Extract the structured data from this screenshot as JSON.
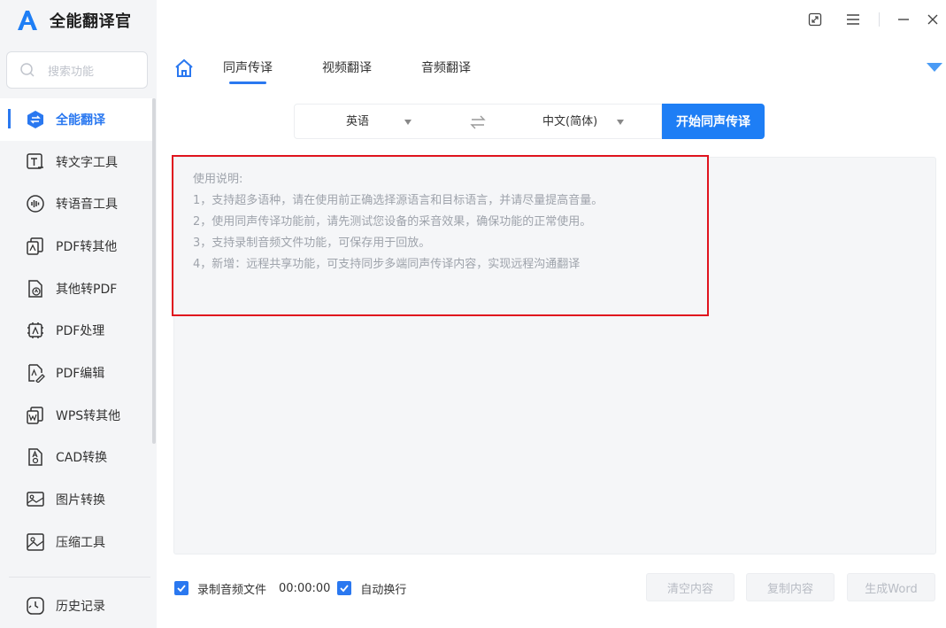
{
  "app": {
    "title": "全能翻译官"
  },
  "search": {
    "placeholder": "搜索功能"
  },
  "sidebar": {
    "items": [
      {
        "label": "全能翻译",
        "icon": "translate-icon",
        "active": true
      },
      {
        "label": "转文字工具",
        "icon": "text-tool-icon"
      },
      {
        "label": "转语音工具",
        "icon": "voice-tool-icon"
      },
      {
        "label": "PDF转其他",
        "icon": "pdf-convert-icon"
      },
      {
        "label": "其他转PDF",
        "icon": "to-pdf-icon"
      },
      {
        "label": "PDF处理",
        "icon": "pdf-process-icon"
      },
      {
        "label": "PDF编辑",
        "icon": "pdf-edit-icon"
      },
      {
        "label": "WPS转其他",
        "icon": "wps-convert-icon"
      },
      {
        "label": "CAD转换",
        "icon": "cad-convert-icon"
      },
      {
        "label": "图片转换",
        "icon": "image-convert-icon"
      },
      {
        "label": "压缩工具",
        "icon": "compress-icon"
      }
    ],
    "history": {
      "label": "历史记录",
      "icon": "history-icon"
    }
  },
  "tabs": [
    {
      "label": "同声传译",
      "active": true
    },
    {
      "label": "视频翻译"
    },
    {
      "label": "音频翻译"
    }
  ],
  "language": {
    "source": "英语",
    "target": "中文(简体)",
    "start_button": "开始同声传译"
  },
  "instructions": {
    "title": "使用说明:",
    "lines": [
      "1，支持超多语种，请在使用前正确选择源语言和目标语言，并请尽量提高音量。",
      "2，使用同声传译功能前，请先测试您设备的采音效果，确保功能的正常使用。",
      "3，支持录制音频文件功能，可保存用于回放。",
      "4，新增：远程共享功能，可支持同步多端同声传译内容，实现远程沟通翻译"
    ]
  },
  "bottom": {
    "record_label": "录制音频文件",
    "timer": "00:00:00",
    "auto_wrap_label": "自动换行",
    "clear_button": "清空内容",
    "copy_button": "复制内容",
    "word_button": "生成Word"
  },
  "colors": {
    "accent": "#1e7ef5",
    "highlight": "#e0141e"
  }
}
